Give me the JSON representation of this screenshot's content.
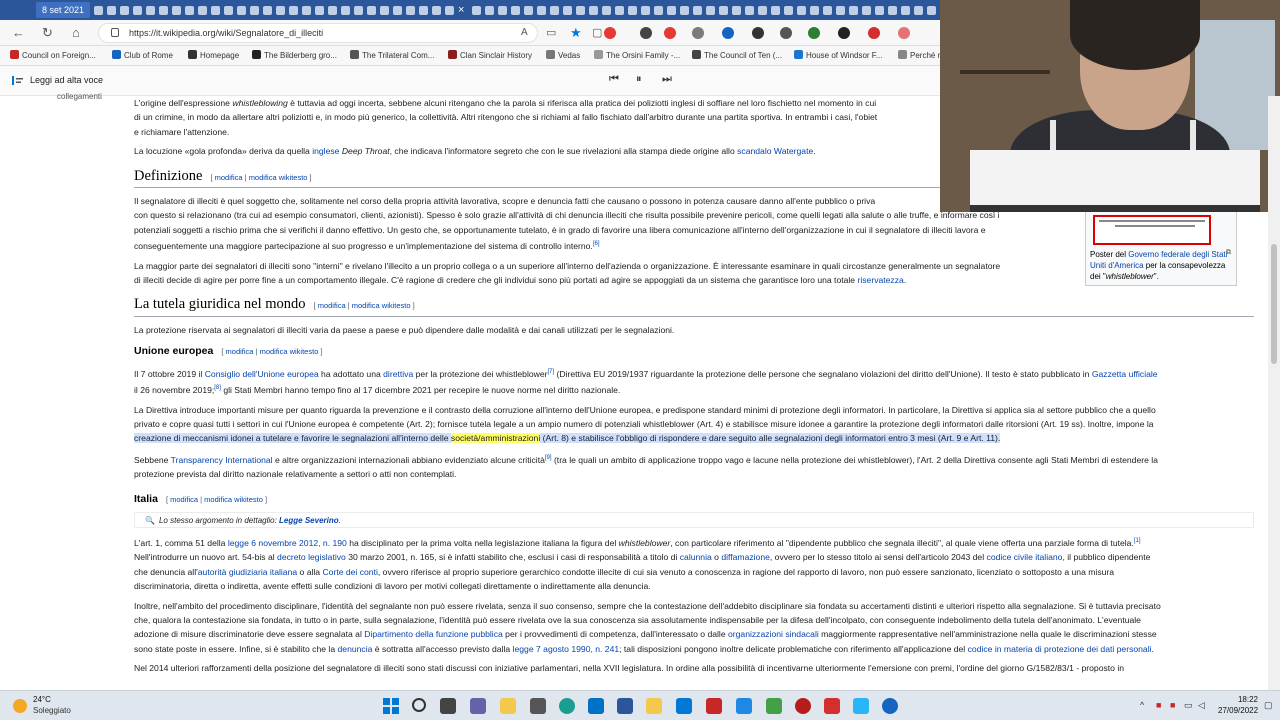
{
  "tab": {
    "date_label": "8 set 2021"
  },
  "address": {
    "url": "https://it.wikipedia.org/wiki/Segnalatore_di_illeciti"
  },
  "bookmarks": [
    "Council on Foreign...",
    "Club of Rome",
    "Homepage",
    "The Bilderberg gro...",
    "The Trilateral Com...",
    "Clan Sinclair History",
    "Vedas",
    "The Orsini Family -...",
    "The Council of Ten (...",
    "House of Windsor F...",
    "Perché r"
  ],
  "readbar": {
    "label": "Leggi ad alta voce"
  },
  "leftcol": {
    "fragment": "collegamenti"
  },
  "intro": {
    "p1_a": "L'origine dell'espressione ",
    "p1_i": "whistleblowing",
    "p1_b": " è tuttavia ad oggi incerta, sebbene alcuni ritengano che la parola si riferisca alla pratica dei poliziotti inglesi di soffiare nel loro fischietto nel momento in cui",
    "p1_c": "di un crimine, in modo da allertare altri poliziotti e, in modo più generico, la collettività. Altri ritengono che si richiami al fallo fischiato dall'arbitro durante una partita sportiva. In entrambi i casi, l'obiet",
    "p1_d": "e richiamare l'attenzione.",
    "p2_a": "La locuzione «gola profonda» deriva da quella ",
    "p2_link": "inglese",
    "p2_i": " Deep Throat",
    "p2_b": ", che indicava l'informatore segreto che con le sue rivelazioni alla stampa diede origine allo ",
    "p2_link2": "scandalo Watergate",
    "p2_c": "."
  },
  "edit": {
    "open": "[ ",
    "modifica": "modifica",
    "sep": " | ",
    "wikitesto": "modifica wikitesto",
    "close": " ]"
  },
  "definizione": {
    "title": "Definizione",
    "p1_l1": "Il segnalatore di illeciti è quel soggetto che, solitamente nel corso della propria attività lavorativa, scopre e denuncia fatti che causano o possono in potenza causare danno all'ente pubblico o priva",
    "p1_l2": "con questo si relazionano (tra cui ad esempio consumatori, clienti, azionisti). Spesso è solo grazie all'attività di chi denuncia illeciti che risulta possibile prevenire pericoli, come quelli legati alla salute o alle truffe, e informare così i",
    "p1_l3": "potenziali soggetti a rischio prima che si verifichi il danno effettivo. Un gesto che, se opportunamente tutelato, è in grado di favorire una libera comunicazione all'interno dell'organizzazione in cui il segnalatore di illeciti lavora e",
    "p1_l4": "conseguentemente una maggiore partecipazione al suo progresso e un'implementazione del sistema di controllo interno.",
    "p1_ref": "[6]",
    "p2_l1": "La maggior parte dei segnalatori di illeciti sono \"interni\" e rivelano l'illecito a un proprio collega o a un superiore all'interno dell'azienda o organizzazione. È interessante esaminare in quali circostanze generalmente un segnalatore",
    "p2_l2": "di illeciti decide di agire per porre fine a un comportamento illegale. C'è ragione di credere che gli individui sono più portati ad agire se appoggiati da un sistema che garantisce loro una totale ",
    "p2_link": "riservatezza",
    "p2_end": "."
  },
  "tutela": {
    "title": "La tutela giuridica nel mondo",
    "p1": "La protezione riservata ai segnalatori di illeciti varia da paese a paese e può dipendere dalle modalità e dai canali utilizzati per le segnalazioni."
  },
  "ue": {
    "title": "Unione europea",
    "p1_a": "Il 7 ottobre 2019 il ",
    "p1_link1": "Consiglio dell'Unione europea",
    "p1_b": " ha adottato una ",
    "p1_link2": "direttiva",
    "p1_c": " per la protezione dei whistleblower",
    "p1_ref1": "[7]",
    "p1_d": " (Direttiva EU 2019/1937 riguardante la protezione delle persone che segnalano violazioni del diritto dell'Unione). Il testo è stato pubblicato in ",
    "p1_link3": "Gazzetta ufficiale",
    "p1_e": "il 26 novembre 2019;",
    "p1_ref2": "[8]",
    "p1_f": " gli Stati Membri hanno tempo fino al 17 dicembre 2021 per recepire le nuove norme nel diritto nazionale.",
    "p2_l1": "La Direttiva introduce importanti misure per quanto riguarda la prevenzione e il contrasto della corruzione all'interno dell'Unione europea, e predispone standard minimi di protezione degli informatori. In particolare, la Direttiva si applica sia al settore pubblico che a quello",
    "p2_l2": "privato e copre quasi tutti i settori in cui l'Unione europea è competente (Art. 2); fornisce tutela legale a un ampio numero di potenziali whistleblower (Art. 4) e stabilisce misure idonee a garantire la protezione degli informatori dalle ritorsioni (Art. 19 ss). Inoltre, impone la",
    "p2_l3a": "creazione di meccanismi idonei a tutelare e favorire le segnalazioni all'interno delle ",
    "p2_l3hl": "società/amministrazioni",
    "p2_l3b": " (Art. 8) e stabilisce l'obbligo di rispondere e dare seguito alle segnalazioni degli informatori entro 3 mesi (Art. 9 e Art. 11).",
    "p3_a": "Sebbene ",
    "p3_link": "Transparency International",
    "p3_b": " e altre organizzazioni internazionali abbiano evidenziato alcune criticità",
    "p3_ref": "[9]",
    "p3_c": " (tra le quali un ambito di applicazione troppo vago e lacune nella protezione dei whistleblower), l'Art. 2 della Direttiva consente agli Stati Membri di estendere la",
    "p3_d": "protezione prevista dal diritto nazionale relativamente a settori o atti non contemplati."
  },
  "italia": {
    "title": "Italia",
    "seealso_a": "Lo stesso argomento in dettaglio: ",
    "seealso_link": "Legge Severino",
    "seealso_b": ".",
    "p1_a": "L'art. 1, comma 51 della ",
    "p1_link1": "legge 6 novembre 2012, n. 190",
    "p1_b": " ha disciplinato per la prima volta nella legislazione italiana la figura del ",
    "p1_i": "whistleblower",
    "p1_c": ", con particolare riferimento al \"dipendente pubblico che segnala illeciti\", al quale viene offerta una parziale forma di tutela.",
    "p1_ref": "[1]",
    "p2_l1a": "Nell'introdurre un nuovo art. 54-bis al ",
    "p2_link1": "decreto legislativo",
    "p2_l1b": " 30 marzo 2001, n. 165, si è infatti stabilito che, esclusi i casi di responsabilità a titolo di ",
    "p2_link2": "calunnia",
    "p2_l1c": " o ",
    "p2_link3": "diffamazione",
    "p2_l1d": ", ovvero per lo stesso titolo ai sensi dell'articolo 2043 del ",
    "p2_link4": "codice civile italiano",
    "p2_l1e": ", il pubblico dipendente",
    "p2_l2a": "che denuncia all'",
    "p2_link5": "autorità giudiziaria italiana",
    "p2_l2b": " o alla ",
    "p2_link6": "Corte dei conti",
    "p2_l2c": ", ovvero riferisce al proprio superiore gerarchico condotte illecite di cui sia venuto a conoscenza in ragione del rapporto di lavoro, non può essere sanzionato, licenziato o sottoposto a una misura",
    "p2_l3": "discriminatoria, diretta o indiretta, avente effetti sulle condizioni di lavoro per motivi collegati direttamente o indirettamente alla denuncia.",
    "p3_l1": "Inoltre, nell'ambito del procedimento disciplinare, l'identità del segnalante non può essere rivelata, senza il suo consenso, sempre che la contestazione dell'addebito disciplinare sia fondata su accertamenti distinti e ulteriori rispetto alla segnalazione. Si è tuttavia precisato",
    "p3_l2": "che, qualora la contestazione sia fondata, in tutto o in parte, sulla segnalazione, l'identità può essere rivelata ove la sua conoscenza sia assolutamente indispensabile per la difesa dell'incolpato, con conseguente indebolimento della tutela dell'anonimato. L'eventuale",
    "p3_l3a": "adozione di misure discriminatorie deve essere segnalata al ",
    "p3_link1": "Dipartimento della funzione pubblica",
    "p3_l3b": " per i provvedimenti di competenza, dall'interessato o dalle ",
    "p3_link2": "organizzazioni sindacali",
    "p3_l3c": " maggiormente rappresentative nell'amministrazione nella quale le discriminazioni stesse",
    "p3_l4a": "sono state poste in essere. Infine, si è stabilito che la ",
    "p3_link3": "denuncia",
    "p3_l4b": " è sottratta all'accesso previsto dalla ",
    "p3_link4": "legge 7 agosto 1990, n. 241",
    "p3_l4c": "; tali disposizioni pongono inoltre delicate problematiche con riferimento all'applicazione del ",
    "p3_link5": "codice in materia di protezione dei dati personali",
    "p3_l4d": ".",
    "p4": "Nel 2014 ulteriori rafforzamenti della posizione del segnalatore di illeciti sono stati discussi con iniziative parlamentari, nella XVII legislatura. In ordine alla possibilità di incentivarne ulteriormente l'emersione con premi, l'ordine del giorno G/1582/83/1 - proposto in"
  },
  "infobox": {
    "caption_a": "Poster del ",
    "caption_link": "Governo federale degli Stati Uniti d'America",
    "caption_b": " per la consapevolezza dei \"",
    "caption_i": "whistleblower",
    "caption_c": "\"."
  },
  "taskbar": {
    "temp": "24°C",
    "weather": "Soleggiato",
    "time": "18:22",
    "date": "27/09/2022"
  }
}
